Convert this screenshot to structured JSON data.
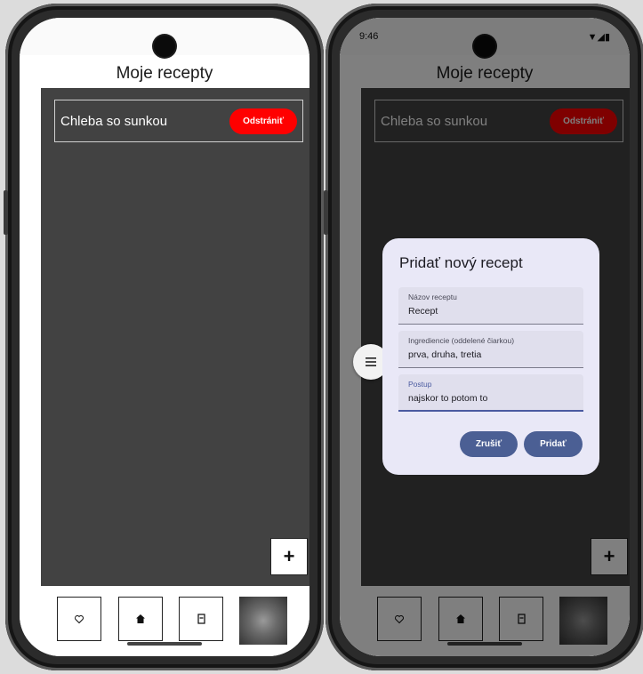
{
  "left": {
    "status": {
      "time": "",
      "icons": ""
    },
    "app_title": "Moje recepty",
    "recipe": {
      "name": "Chleba so sunkou",
      "delete_label": "Odstrániť"
    },
    "fab_label": "+"
  },
  "right": {
    "status": {
      "time": "9:46",
      "icons": "▼◢▮"
    },
    "app_title": "Moje recepty",
    "recipe": {
      "name": "Chleba so sunkou",
      "delete_label": "Odstrániť"
    },
    "fab_label": "+",
    "dialog": {
      "title": "Pridať nový recept",
      "fields": [
        {
          "label": "Názov receptu",
          "value": "Recept"
        },
        {
          "label": "Ingrediencie (oddelené čiarkou)",
          "value": "prva, druha, tretia"
        },
        {
          "label": "Postup",
          "value": "najskor to potom to"
        }
      ],
      "cancel_label": "Zrušiť",
      "add_label": "Pridať"
    }
  },
  "nav_icons": [
    "heart-icon",
    "home-icon",
    "book-icon",
    "profile-image"
  ],
  "colors": {
    "delete_button": "#ff0000",
    "dialog_button": "#4b5f94",
    "content_background": "#424242",
    "dialog_background": "#e9e8f7"
  }
}
